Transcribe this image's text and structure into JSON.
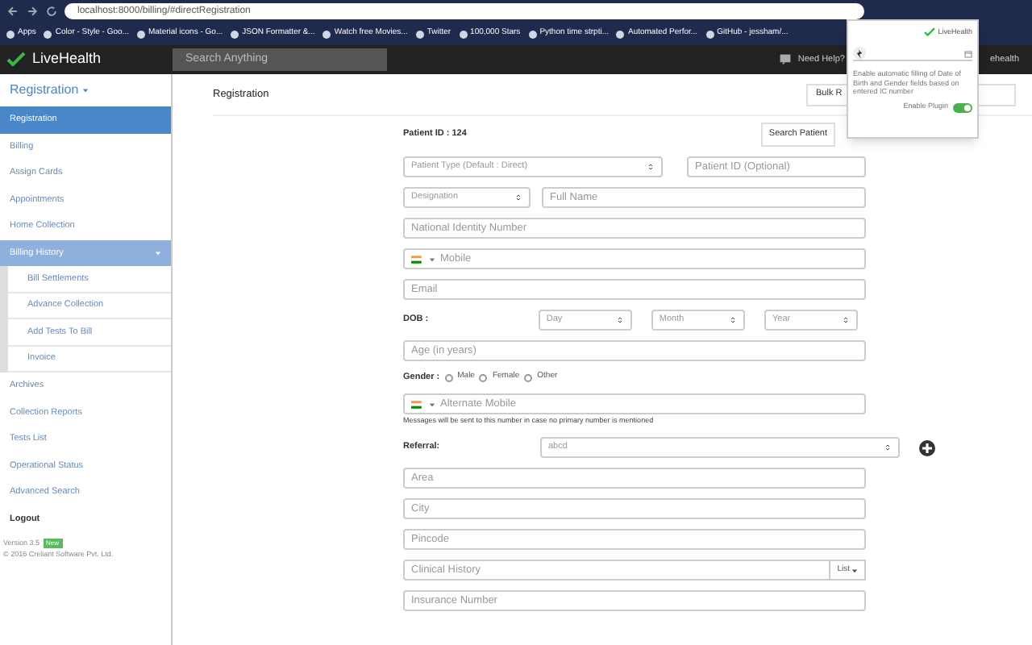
{
  "browser": {
    "url": "localhost:8000/billing/#directRegistration",
    "bookmarks": [
      "Apps",
      "Color - Style - Goo...",
      "Material icons - Go...",
      "JSON Formatter &...",
      "Watch free Movies...",
      "Twitter",
      "100,000 Stars",
      "Python time strpti...",
      "Automated Perfor...",
      "GitHub - jessham/..."
    ]
  },
  "header": {
    "logo": "LiveHealth",
    "search_placeholder": "Search Anything",
    "help": "Need Help?",
    "user": "ehealth"
  },
  "sidebar": {
    "title": "Registration",
    "items": [
      {
        "label": "Registration",
        "selected": true
      },
      {
        "label": "Billing",
        "selected": false
      },
      {
        "label": "Assign Cards",
        "selected": false
      },
      {
        "label": "Appointments",
        "selected": false
      },
      {
        "label": "Home Collection",
        "selected": false
      },
      {
        "label": "Billing History",
        "selected": false,
        "expanded": true,
        "children": [
          {
            "label": "Bill Settlements",
            "selected": false
          },
          {
            "label": "Advance Collection",
            "selected": false
          },
          {
            "label": "Add Tests To Bill",
            "selected": false
          },
          {
            "label": "Invoice",
            "selected": false
          }
        ]
      },
      {
        "label": "Archives",
        "selected": false
      },
      {
        "label": "Collection Reports",
        "selected": false
      },
      {
        "label": "Tests List",
        "selected": false
      },
      {
        "label": "Operational Status",
        "selected": false
      },
      {
        "label": "Advanced Search",
        "selected": false
      },
      {
        "label": "Logout",
        "selected": false,
        "kind": "logout"
      }
    ],
    "version": "Version 3.5",
    "version_badge": "New",
    "copyright": "© 2016 Creliant Software Pvt. Ltd."
  },
  "content": {
    "title": "Registration",
    "bulk_button": "Bulk R",
    "patient_id": "Patient ID : 124",
    "search_button": "Search Patient",
    "form": [
      {
        "kind": "pair",
        "select": "Patient Type (Default : Direct)",
        "placeholder": "Patient ID (Optional)"
      },
      {
        "kind": "designation",
        "select": "Designation",
        "placeholder": "Full Name"
      },
      {
        "kind": "input",
        "placeholder": "National Identity Number"
      },
      {
        "kind": "phone",
        "placeholder": "Mobile"
      },
      {
        "kind": "input",
        "placeholder": "Email"
      },
      {
        "kind": "dob",
        "label": "DOB :",
        "selects": [
          "Day",
          "Month",
          "Year"
        ]
      },
      {
        "kind": "input",
        "placeholder": "Age (in years)"
      },
      {
        "kind": "gender",
        "label": "Gender :",
        "options": [
          {
            "label": "Male",
            "selected": false
          },
          {
            "label": "Female",
            "selected": false
          },
          {
            "label": "Other",
            "selected": false
          }
        ]
      },
      {
        "kind": "phone",
        "placeholder": "Alternate Mobile",
        "note": "Messages will be sent to this number in case no primary number is mentioned"
      },
      {
        "kind": "referral",
        "label": "Referral:",
        "value": "abcd"
      },
      {
        "kind": "input",
        "placeholder": "Area"
      },
      {
        "kind": "input",
        "placeholder": "City"
      },
      {
        "kind": "input",
        "placeholder": "Pincode"
      },
      {
        "kind": "list",
        "placeholder": "Clinical History",
        "button": "List"
      },
      {
        "kind": "input",
        "placeholder": "Insurance Number"
      }
    ]
  },
  "popup": {
    "brand": "LiveHealth",
    "description": "Enable automatic filling of Date of Birth and Gender fields based on entered IC number",
    "toggle_label": "Enable Plugin",
    "on": true
  }
}
